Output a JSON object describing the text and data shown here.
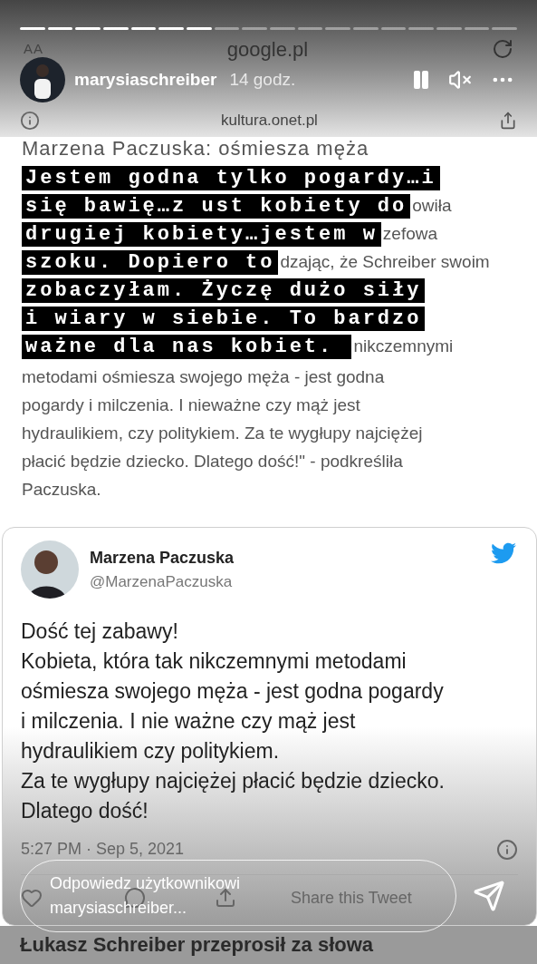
{
  "story": {
    "progress": [
      {
        "watched": true
      },
      {
        "watched": true
      },
      {
        "watched": true
      },
      {
        "watched": true
      },
      {
        "watched": true
      },
      {
        "watched": true
      },
      {
        "watched": true
      },
      {
        "watched": false
      },
      {
        "watched": false
      },
      {
        "watched": false
      },
      {
        "watched": false
      },
      {
        "watched": false
      },
      {
        "watched": false
      },
      {
        "watched": false
      },
      {
        "watched": false
      },
      {
        "watched": false
      },
      {
        "watched": false
      },
      {
        "watched": false
      }
    ],
    "username": "marysiaschreiber",
    "time": "14 godz."
  },
  "browser": {
    "text_size": "AA",
    "domain": "google.pl"
  },
  "article": {
    "site": "kultura.onet.pl",
    "heading": "Marzena Paczuska: ośmiesza męża",
    "quote_lines": [
      {
        "redacted": "Jestem godna tylko pogardy…i"
      },
      {
        "redacted": "się bawię…z ust kobiety do",
        "visible": "owiła"
      },
      {
        "redacted": "drugiej kobiety…jestem w",
        "visible": "zefowa"
      },
      {
        "redacted": "szoku. Dopiero to",
        "visible": "dzając, że Schreiber swoim"
      },
      {
        "redacted": "zobaczyłam. Życzę dużo siły"
      },
      {
        "redacted": "i wiary w siebie. To bardzo"
      },
      {
        "redacted": "ważne dla nas kobiet. ",
        "visible": "nikczemnymi"
      }
    ],
    "body": [
      "metodami ośmiesza swojego męża - jest godna",
      "pogardy i milczenia. I nieważne czy mąż jest",
      "hydraulikiem, czy politykiem. Za te wygłupy najciężej",
      "płacić będzie dziecko. Dlatego dość!\" - podkreśliła",
      "Paczuska."
    ]
  },
  "tweet": {
    "name": "Marzena Paczuska",
    "handle": "@MarzenaPaczuska",
    "lines": [
      "Dość tej zabawy!",
      "Kobieta, która tak nikczemnymi metodami",
      "ośmiesza swojego męża - jest godna pogardy",
      "i milczenia. I nie ważne czy mąż jest",
      "hydraulikiem czy politykiem.",
      "Za te wygłupy najciężej płacić będzie dziecko.",
      "Dlatego dość!"
    ],
    "timestamp": "5:27 PM · Sep 5, 2021",
    "share": "Share this Tweet"
  },
  "reply": {
    "placeholder": "Odpowiedz użytkownikowi marysiaschreiber..."
  },
  "next_headline": "Łukasz Schreiber przeprosił za słowa"
}
